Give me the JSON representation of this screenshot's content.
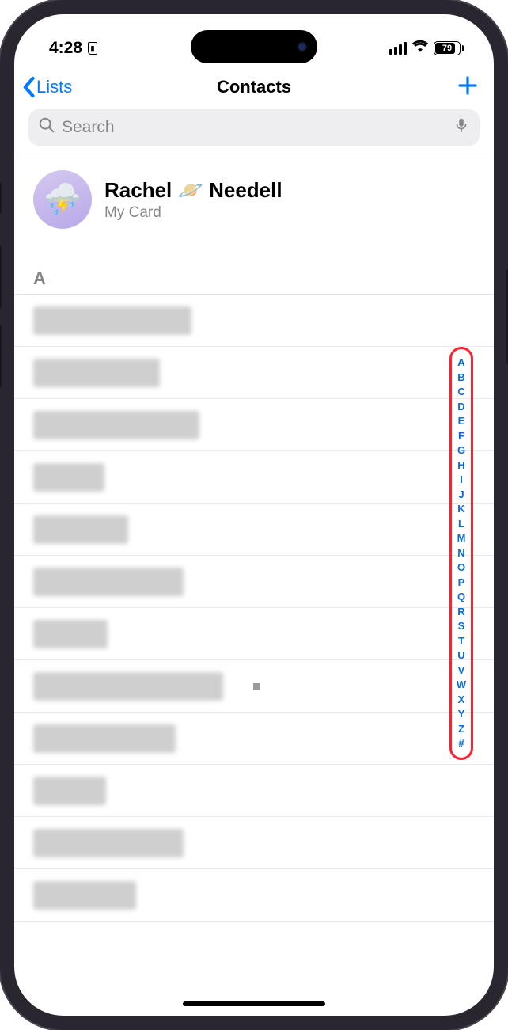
{
  "status": {
    "time": "4:28",
    "battery_pct": "79"
  },
  "nav": {
    "back_label": "Lists",
    "title": "Contacts"
  },
  "search": {
    "placeholder": "Search"
  },
  "my_card": {
    "name": "Rachel 🪐 Needell",
    "sub": "My Card",
    "avatar_emoji": "⛈️"
  },
  "section": {
    "header": "A"
  },
  "contact_widths": [
    200,
    160,
    210,
    90,
    120,
    190,
    94,
    240,
    180,
    92,
    190,
    130
  ],
  "index_letters": [
    "A",
    "B",
    "C",
    "D",
    "E",
    "F",
    "G",
    "H",
    "I",
    "J",
    "K",
    "L",
    "M",
    "N",
    "O",
    "P",
    "Q",
    "R",
    "S",
    "T",
    "U",
    "V",
    "W",
    "X",
    "Y",
    "Z",
    "#"
  ]
}
